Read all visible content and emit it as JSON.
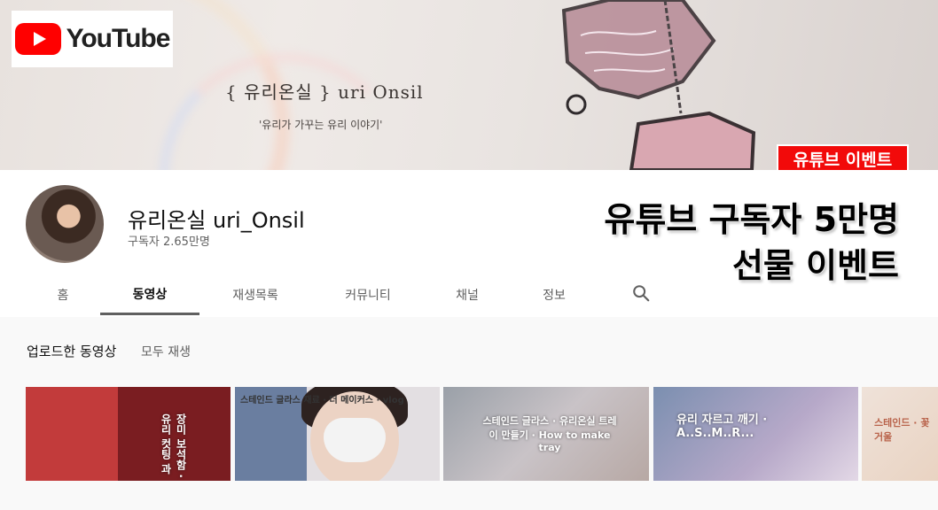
{
  "banner": {
    "title": "{ 유리온실 } uri Onsil",
    "subtitle": "'유리가 가꾸는 유리 이야기'",
    "logo_word": "YouTube",
    "event_badge": "유튜브 이벤트"
  },
  "channel": {
    "name": "유리온실 uri_Onsil",
    "subscribers": "구독자 2.65만명"
  },
  "promo": {
    "line1": "유튜브 구독자 5만명",
    "line2": "선물 이벤트"
  },
  "tabs": [
    {
      "label": "홈",
      "active": false
    },
    {
      "label": "동영상",
      "active": true
    },
    {
      "label": "재생목록",
      "active": false
    },
    {
      "label": "커뮤니티",
      "active": false
    },
    {
      "label": "채널",
      "active": false
    },
    {
      "label": "정보",
      "active": false
    }
  ],
  "section": {
    "title": "업로드한 동영상",
    "play_all": "모두 재생"
  },
  "thumbnails": [
    {
      "caption": "장미 보석함 · 유리 컷팅 과"
    },
    {
      "caption": "스테인드 글라스 재료 · 더 메이커스 · vlog"
    },
    {
      "caption": "스테인드 글라스 · 유리온실 트레이 만들기 · How to make tray"
    },
    {
      "caption": "유리 자르고 깨기 · A..S..M..R..."
    },
    {
      "caption": "스테인드 · 꽃 거울"
    }
  ],
  "colors": {
    "brand_red": "#ff0000",
    "badge_red": "#f20a0a"
  },
  "icons": [
    "search-icon",
    "youtube-play-icon"
  ]
}
